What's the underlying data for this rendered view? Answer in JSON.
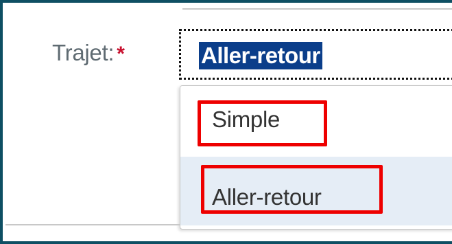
{
  "form": {
    "label": "Trajet:",
    "required_marker": "*",
    "selected_value": "Aller-retour"
  },
  "dropdown": {
    "options": [
      {
        "label": "Simple"
      },
      {
        "label": "Aller-retour"
      }
    ]
  },
  "colors": {
    "frame_border": "#0e4f63",
    "selection_highlight": "#0b3e8a",
    "annotation_box": "#ee0000",
    "hover_option_bg": "#e5edf6",
    "required_star": "#c8102e"
  }
}
